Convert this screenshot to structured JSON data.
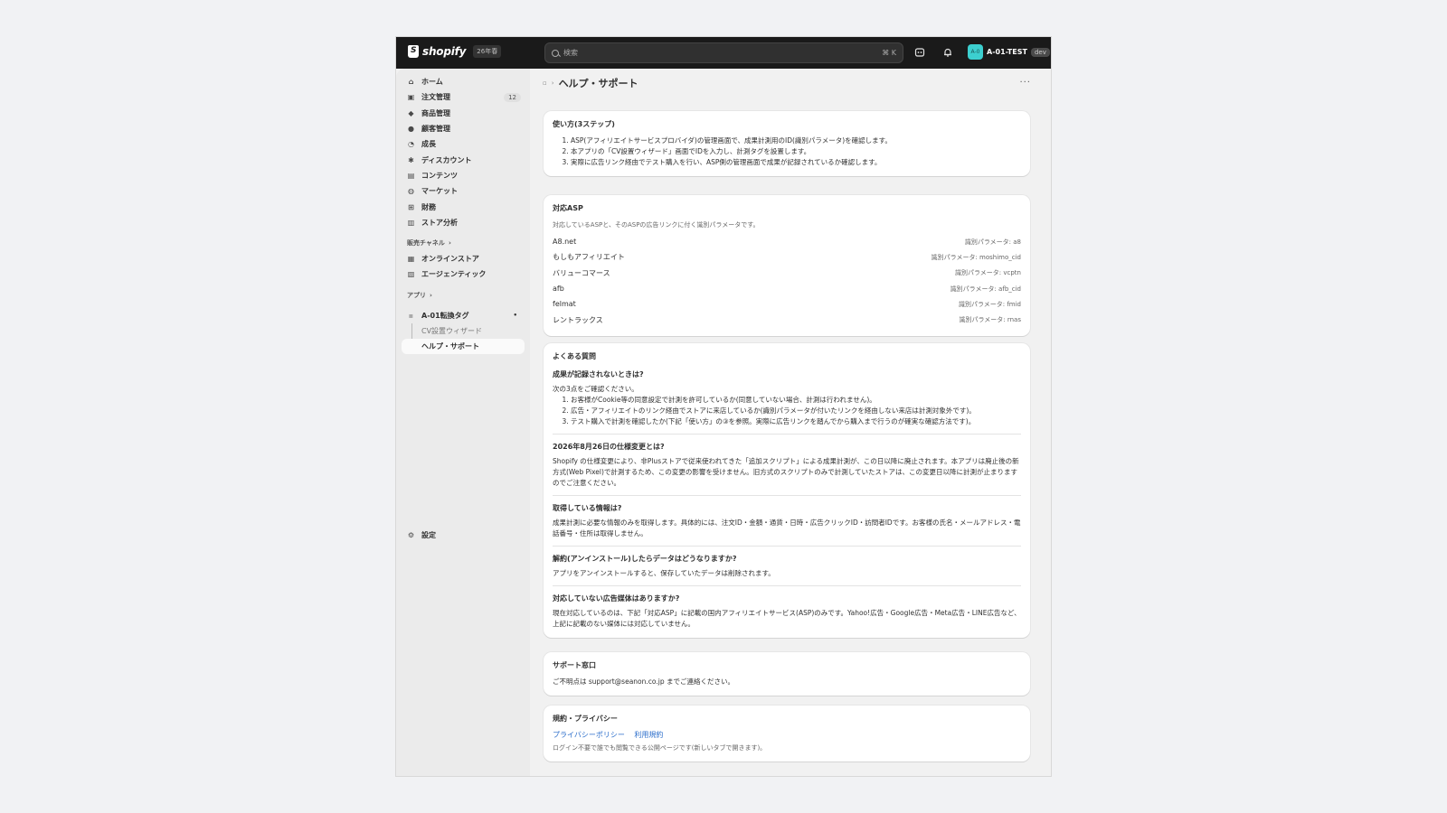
{
  "topbar": {
    "logo_text": "shopify",
    "version_badge": "26年春",
    "search_placeholder": "検索",
    "search_shortcut": "⌘ K",
    "store_avatar": "A-0",
    "store_name": "A-01-TEST",
    "dev_badge": "dev"
  },
  "sidebar": {
    "items": [
      {
        "label": "ホーム",
        "icon": "home-icon"
      },
      {
        "label": "注文管理",
        "icon": "inbox-icon",
        "count": "12"
      },
      {
        "label": "商品管理",
        "icon": "tag-icon"
      },
      {
        "label": "顧客管理",
        "icon": "person-icon"
      },
      {
        "label": "成長",
        "icon": "gauge-icon"
      },
      {
        "label": "ディスカウント",
        "icon": "discount-icon"
      },
      {
        "label": "コンテンツ",
        "icon": "content-icon"
      },
      {
        "label": "マーケット",
        "icon": "globe-icon"
      },
      {
        "label": "財務",
        "icon": "bank-icon"
      },
      {
        "label": "ストア分析",
        "icon": "chart-icon"
      }
    ],
    "sales_channels_label": "販売チャネル",
    "channels": [
      {
        "label": "オンラインストア",
        "icon": "store-icon"
      },
      {
        "label": "エージェンティック",
        "icon": "agentic-icon"
      }
    ],
    "apps_label": "アプリ",
    "app": {
      "label": "A-01転換タグ",
      "icon": "app-icon"
    },
    "app_subitems": [
      "CV設置ウィザード",
      "ヘルプ・サポート"
    ],
    "settings_label": "設定"
  },
  "page": {
    "title": "ヘルプ・サポート",
    "more": "···"
  },
  "howto": {
    "title": "使い方(3ステップ)",
    "steps": [
      "ASP(アフィリエイトサービスプロバイダ)の管理画面で、成果計測用のID(識別パラメータ)を確認します。",
      "本アプリの「CV設置ウィザード」画面でIDを入力し、計測タグを設置します。",
      "実際に広告リンク経由でテスト購入を行い、ASP側の管理画面で成果が記録されているか確認します。"
    ]
  },
  "asp": {
    "title": "対応ASP",
    "description": "対応しているASPと、そのASPの広告リンクに付く識別パラメータです。",
    "rows": [
      {
        "name": "A8.net",
        "param": "識別パラメータ: a8"
      },
      {
        "name": "もしもアフィリエイト",
        "param": "識別パラメータ: moshimo_cid"
      },
      {
        "name": "バリューコマース",
        "param": "識別パラメータ: vcptn"
      },
      {
        "name": "afb",
        "param": "識別パラメータ: afb_cid"
      },
      {
        "name": "felmat",
        "param": "識別パラメータ: fmid"
      },
      {
        "name": "レントラックス",
        "param": "識別パラメータ: rnas"
      }
    ]
  },
  "faq": {
    "title": "よくある質問",
    "q1": {
      "question": "成果が記録されないときは?",
      "intro": "次の3点をご確認ください。",
      "items": [
        "お客様がCookie等の同意設定で計測を許可しているか(同意していない場合、計測は行われません)。",
        "広告・アフィリエイトのリンク経由でストアに来店しているか(識別パラメータが付いたリンクを経由しない来店は計測対象外です)。",
        "テスト購入で計測を確認したか(下記「使い方」の③を参照。実際に広告リンクを踏んでから購入まで行うのが確実な確認方法です)。"
      ]
    },
    "q2": {
      "question": "2026年8月26日の仕様変更とは?",
      "answer": "Shopify の仕様変更により、非Plusストアで従来使われてきた「追加スクリプト」による成果計測が、この日以降に廃止されます。本アプリは廃止後の新方式(Web Pixel)で計測するため、この変更の影響を受けません。旧方式のスクリプトのみで計測していたストアは、この変更日以降に計測が止まりますのでご注意ください。"
    },
    "q3": {
      "question": "取得している情報は?",
      "answer": "成果計測に必要な情報のみを取得します。具体的には、注文ID・金額・通貨・日時・広告クリックID・訪問者IDです。お客様の氏名・メールアドレス・電話番号・住所は取得しません。"
    },
    "q4": {
      "question": "解約(アンインストール)したらデータはどうなりますか?",
      "answer": "アプリをアンインストールすると、保存していたデータは削除されます。"
    },
    "q5": {
      "question": "対応していない広告媒体はありますか?",
      "answer": "現在対応しているのは、下記「対応ASP」に記載の国内アフィリエイトサービス(ASP)のみです。Yahoo!広告・Google広告・Meta広告・LINE広告など、上記に記載のない媒体には対応していません。"
    }
  },
  "support": {
    "title": "サポート窓口",
    "text": "ご不明点は support@seanon.co.jp までご連絡ください。"
  },
  "policy": {
    "title": "規約・プライバシー",
    "privacy_link": "プライバシーポリシー",
    "terms_link": "利用規約",
    "note": "ログイン不要で誰でも閲覧できる公開ページです(新しいタブで開きます)。"
  }
}
